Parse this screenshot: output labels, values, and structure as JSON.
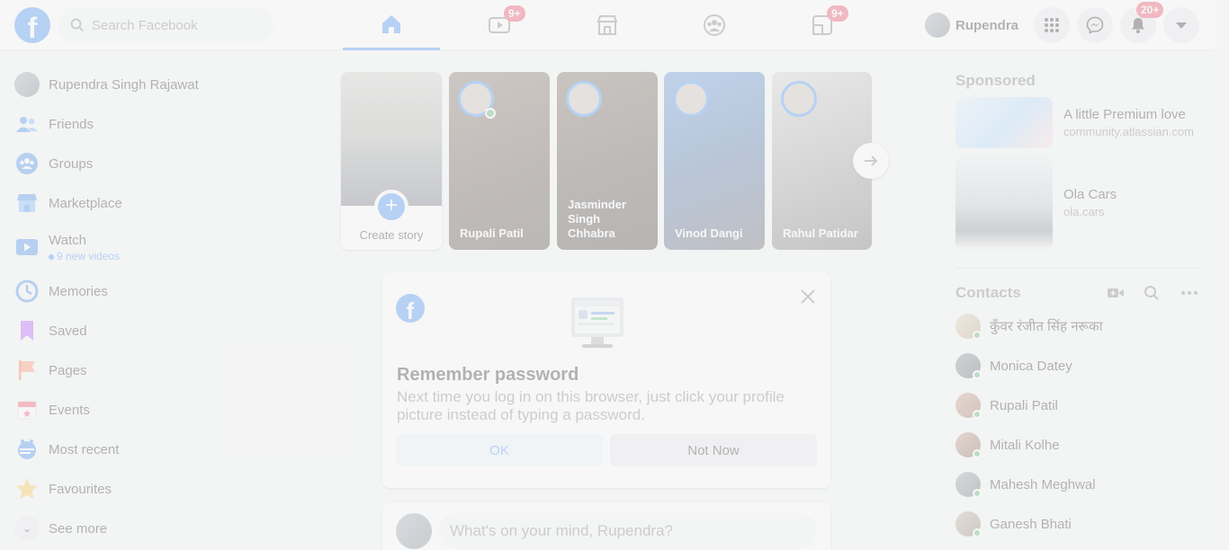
{
  "header": {
    "logo_letter": "f",
    "search_placeholder": "Search Facebook",
    "watch_badge": "9+",
    "gaming_badge": "9+",
    "profile_name": "Rupendra",
    "notifications_badge": "20+"
  },
  "sidebar": {
    "items": [
      {
        "label": "Rupendra Singh Rajawat"
      },
      {
        "label": "Friends"
      },
      {
        "label": "Groups"
      },
      {
        "label": "Marketplace"
      },
      {
        "label": "Watch",
        "sub": "9 new videos"
      },
      {
        "label": "Memories"
      },
      {
        "label": "Saved"
      },
      {
        "label": "Pages"
      },
      {
        "label": "Events"
      },
      {
        "label": "Most recent"
      },
      {
        "label": "Favourites"
      },
      {
        "label": "See more"
      }
    ]
  },
  "stories": {
    "create_label": "Create story",
    "items": [
      {
        "name": "Rupali Patil"
      },
      {
        "name": "Jasminder Singh Chhabra"
      },
      {
        "name": "Vinod Dangi"
      },
      {
        "name": "Rahul Patidar"
      }
    ]
  },
  "remember_password": {
    "title": "Remember password",
    "description": "Next time you log in on this browser, just click your profile picture instead of typing a password.",
    "ok_label": "OK",
    "not_now_label": "Not Now"
  },
  "composer": {
    "placeholder": "What's on your mind, Rupendra?"
  },
  "sponsored": {
    "title": "Sponsored",
    "ads": [
      {
        "title": "A little Premium love",
        "domain": "community.atlassian.com"
      },
      {
        "title": "Ola Cars",
        "domain": "ola.cars"
      }
    ]
  },
  "contacts": {
    "title": "Contacts",
    "items": [
      {
        "name": "कुँवर रंजीत सिंह नरूका"
      },
      {
        "name": "Monica Datey"
      },
      {
        "name": "Rupali Patil"
      },
      {
        "name": "Mitali Kolhe"
      },
      {
        "name": "Mahesh Meghwal"
      },
      {
        "name": "Ganesh Bhati"
      }
    ]
  },
  "colors": {
    "brand": "#1877f2",
    "badge": "#e41e3f",
    "online": "#31a24c"
  }
}
